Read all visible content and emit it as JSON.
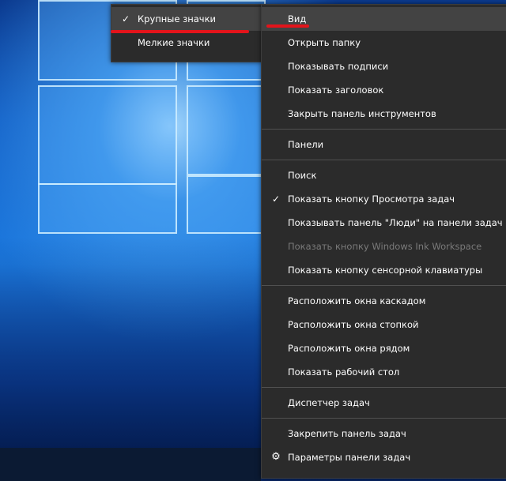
{
  "submenu": {
    "items": [
      {
        "label": "Крупные значки",
        "checked": true,
        "highlighted": true
      },
      {
        "label": "Мелкие значки",
        "checked": false
      }
    ]
  },
  "context_menu": {
    "items": [
      {
        "label": "Вид",
        "highlighted": true
      },
      {
        "label": "Открыть папку"
      },
      {
        "label": "Показывать подписи"
      },
      {
        "label": "Показать заголовок"
      },
      {
        "label": "Закрыть панель инструментов"
      },
      {
        "label": "Панели"
      },
      {
        "label": "Поиск"
      },
      {
        "label": "Показать кнопку Просмотра задач",
        "checked": true
      },
      {
        "label": "Показывать панель \"Люди\" на панели задач"
      },
      {
        "label": "Показать кнопку Windows Ink Workspace",
        "disabled": true
      },
      {
        "label": "Показать кнопку сенсорной клавиатуры"
      },
      {
        "label": "Расположить окна каскадом"
      },
      {
        "label": "Расположить окна стопкой"
      },
      {
        "label": "Расположить окна рядом"
      },
      {
        "label": "Показать рабочий стол"
      },
      {
        "label": "Диспетчер задач"
      },
      {
        "label": "Закрепить панель задач"
      },
      {
        "label": "Параметры панели задач",
        "icon": "gear-icon"
      }
    ]
  },
  "icons": {
    "check": "✓",
    "gear": "⚙"
  },
  "colors": {
    "menu_bg": "#2b2b2b",
    "highlight": "#434343",
    "annotation": "#e3141b"
  }
}
